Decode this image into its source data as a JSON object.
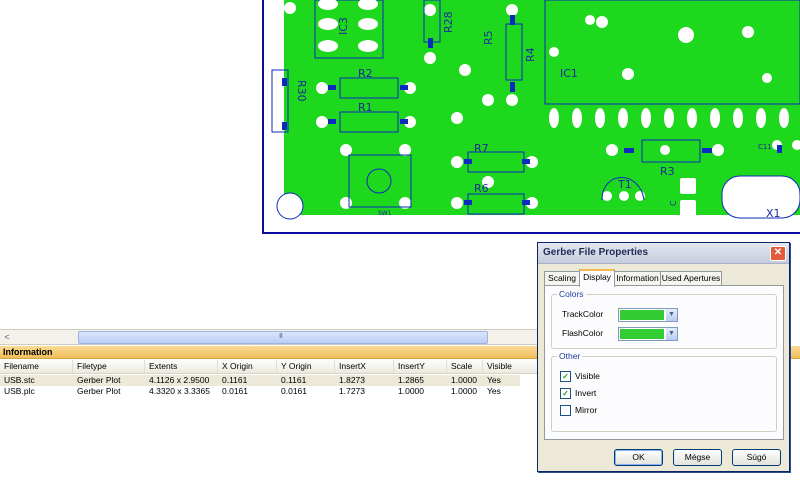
{
  "pcb": {
    "labels": {
      "ic3": "IC3",
      "r28": "R28",
      "r5": "R5",
      "r4": "R4",
      "ic1": "IC1",
      "r30": "R30",
      "r2": "R2",
      "r1": "R1",
      "r7": "R7",
      "r6": "R6",
      "r3": "R3",
      "t1": "T1",
      "c11": "C11",
      "sw1": "SW1",
      "x1": "X1",
      "c": "C"
    },
    "colors": {
      "copper": "#1ed81e",
      "outline": "#0c0ca0",
      "trace": "#0b2bbd"
    }
  },
  "scrollbar": {
    "left_arrow": "<",
    "grip": "III"
  },
  "info": {
    "header": "Information",
    "columns": [
      "Filename",
      "Filetype",
      "Extents",
      "X Origin",
      "Y Origin",
      "InsertX",
      "InsertY",
      "Scale",
      "Visible"
    ],
    "rows": [
      [
        "USB.stc",
        "Gerber Plot",
        "4.1126 x 2.9500",
        "0.1161",
        "0.1161",
        "1.8273",
        "1.2865",
        "1.0000",
        "Yes"
      ],
      [
        "USB.plc",
        "Gerber Plot",
        "4.3320 x 3.3365",
        "0.0161",
        "0.0161",
        "1.7273",
        "1.0000",
        "1.0000",
        "Yes"
      ]
    ]
  },
  "dialog": {
    "title": "Gerber File Properties",
    "close_glyph": "✕",
    "tabs": [
      "Scaling",
      "Display",
      "Information",
      "Used Apertures"
    ],
    "active_tab": "Display",
    "colors_group": "Colors",
    "track_color_label": "TrackColor",
    "flash_color_label": "FlashColor",
    "track_color": "#33cc33",
    "flash_color": "#33cc33",
    "other_group": "Other",
    "visible_label": "Visible",
    "invert_label": "Invert",
    "mirror_label": "Mirror",
    "visible_checked": true,
    "invert_checked": true,
    "mirror_checked": false,
    "check_glyph": "✓",
    "dropdown_glyph": "▼",
    "ok_label": "OK",
    "cancel_label": "Mégse",
    "help_label": "Súgó"
  }
}
